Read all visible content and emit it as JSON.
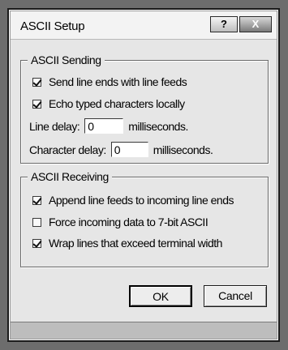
{
  "window": {
    "title": "ASCII Setup",
    "help_label": "?",
    "close_label": "X"
  },
  "sending": {
    "title": "ASCII Sending",
    "send_line_ends": {
      "label": "Send line ends with line feeds",
      "checked": true
    },
    "echo_typed": {
      "label": "Echo typed characters locally",
      "checked": true
    },
    "line_delay": {
      "label": "Line delay:",
      "value": "0",
      "unit": "milliseconds."
    },
    "char_delay": {
      "label": "Character delay:",
      "value": "0",
      "unit": "milliseconds."
    }
  },
  "receiving": {
    "title": "ASCII Receiving",
    "append_line_feeds": {
      "label": "Append line feeds to incoming line ends",
      "checked": true
    },
    "force_7bit": {
      "label": "Force incoming data to 7-bit ASCII",
      "checked": false
    },
    "wrap_lines": {
      "label": "Wrap lines that exceed terminal width",
      "checked": true
    }
  },
  "buttons": {
    "ok": "OK",
    "cancel": "Cancel"
  }
}
